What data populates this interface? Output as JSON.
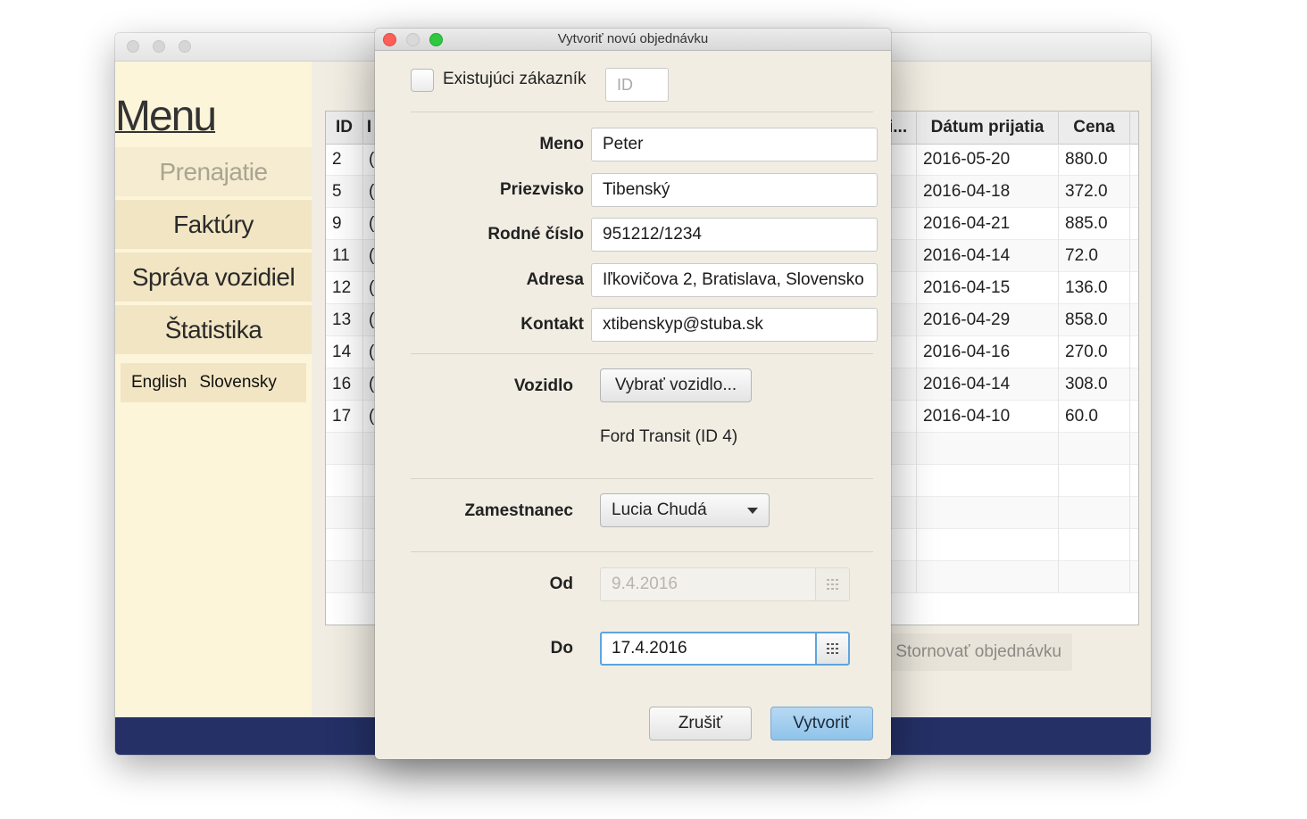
{
  "main_window": {
    "sidebar": {
      "menu_title": "Menu",
      "nav_items": [
        "Prenajatie",
        "Faktúry",
        "Správa vozidiel",
        "Štatistika"
      ],
      "languages": [
        "English",
        "Slovensky"
      ]
    },
    "table": {
      "columns": [
        "ID",
        "I",
        "i...",
        "Dátum prijatia",
        "Cena"
      ],
      "rows": [
        {
          "id": "2",
          "c2": "(",
          "date": "2016-05-20",
          "price": "880.0"
        },
        {
          "id": "5",
          "c2": "(",
          "date": "2016-04-18",
          "price": "372.0"
        },
        {
          "id": "9",
          "c2": "(",
          "date": "2016-04-21",
          "price": "885.0"
        },
        {
          "id": "11",
          "c2": "(",
          "date": "2016-04-14",
          "price": "72.0"
        },
        {
          "id": "12",
          "c2": "(",
          "date": "2016-04-15",
          "price": "136.0"
        },
        {
          "id": "13",
          "c2": "(",
          "date": "2016-04-29",
          "price": "858.0"
        },
        {
          "id": "14",
          "c2": "(",
          "date": "2016-04-16",
          "price": "270.0"
        },
        {
          "id": "16",
          "c2": "(",
          "date": "2016-04-14",
          "price": "308.0"
        },
        {
          "id": "17",
          "c2": "(",
          "date": "2016-04-10",
          "price": "60.0"
        }
      ]
    },
    "cancel_order_label": "Stornovať objednávku"
  },
  "dialog": {
    "title": "Vytvoriť novú objednávku",
    "existing_customer_label": "Existujúci zákazník",
    "id_placeholder": "ID",
    "fields": {
      "meno": {
        "label": "Meno",
        "value": "Peter"
      },
      "priezvisko": {
        "label": "Priezvisko",
        "value": "Tibenský"
      },
      "rodne_cislo": {
        "label": "Rodné číslo",
        "value": "951212/1234"
      },
      "adresa": {
        "label": "Adresa",
        "value": "Iľkovičova 2, Bratislava, Slovensko"
      },
      "kontakt": {
        "label": "Kontakt",
        "value": "xtibenskyp@stuba.sk"
      }
    },
    "vehicle": {
      "label": "Vozidlo",
      "button": "Vybrať vozidlo...",
      "selected": "Ford Transit (ID 4)"
    },
    "employee": {
      "label": "Zamestnanec",
      "selected": "Lucia Chudá"
    },
    "date_from": {
      "label": "Od",
      "value": "9.4.2016"
    },
    "date_to": {
      "label": "Do",
      "value": "17.4.2016"
    },
    "buttons": {
      "cancel": "Zrušiť",
      "create": "Vytvoriť"
    }
  }
}
